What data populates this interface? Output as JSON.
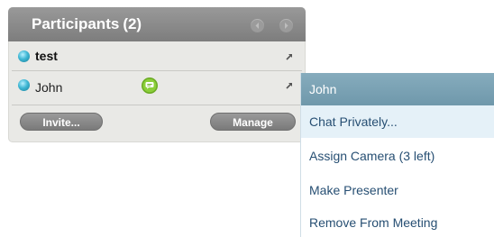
{
  "panel": {
    "title": "Participants",
    "count": "(2)",
    "nav_prev_icon": "chevron-left-icon",
    "nav_next_icon": "chevron-right-icon"
  },
  "participants": [
    {
      "name": "test",
      "status_icon": "status-dot-icon",
      "action_icon": "expand-arrow-icon"
    },
    {
      "name": "John",
      "status_icon": "status-dot-icon",
      "badge_icon": "chat-bubble-icon",
      "action_icon": "expand-arrow-icon"
    }
  ],
  "buttons": {
    "invite": "Invite...",
    "manage": "Manage"
  },
  "context_menu": {
    "header": "John",
    "items": [
      "Chat Privately...",
      "Assign Camera (3 left)",
      "Make Presenter",
      "Remove From Meeting"
    ]
  },
  "colors": {
    "panel_header": "#888888",
    "panel_body": "#e9e9e6",
    "menu_header": "#7aa2b4",
    "menu_text": "#274f73",
    "menu_highlight": "#e5f1f8",
    "status_dot": "#3fb7d4",
    "chat_badge": "#7cbf2e"
  }
}
